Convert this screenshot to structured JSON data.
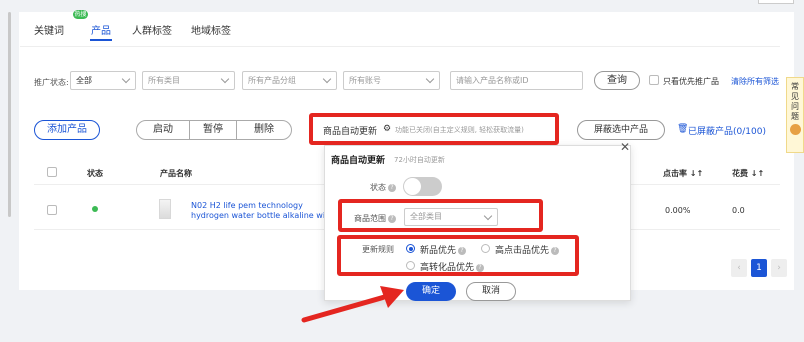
{
  "tabs": [
    {
      "label": "关键词",
      "badge": "热搜"
    },
    {
      "label": "产品"
    },
    {
      "label": "人群标签"
    },
    {
      "label": "地域标签"
    }
  ],
  "filters": {
    "status_label": "推广状态:",
    "status_value": "全部",
    "category_placeholder": "所有类目",
    "group_placeholder": "所有产品分组",
    "account_placeholder": "所有账号",
    "search_placeholder": "请输入产品名称或ID",
    "search_button": "查询",
    "priority_only_label": "只看优先推广品",
    "clear_link": "清除所有筛选"
  },
  "toolbar": {
    "add_product": "添加产品",
    "start": "启动",
    "pause": "暂停",
    "delete": "删除",
    "auto_update_label": "商品自动更新",
    "auto_update_hint": "功能已关闭(自主定义规则, 轻松获取流量)",
    "block_selected": "屏蔽选中产品",
    "blocked_link": "已屏蔽产品(0/100)"
  },
  "table": {
    "headers": [
      "状态",
      "产品名称",
      "点击率 ↓↑",
      "花费 ↓↑"
    ],
    "rows": [
      {
        "title_line1": "N02 H2 life pem technology",
        "title_line2": "hydrogen water bottle alkaline wit...",
        "ctr": "0.00%",
        "cost": "0.0"
      }
    ]
  },
  "pager": {
    "current": "1"
  },
  "help_widget": [
    "常",
    "见",
    "问",
    "题"
  ],
  "popup": {
    "title": "商品自动更新",
    "subtitle": "72小时自动更新",
    "status_label": "状态",
    "scope_label": "商品范围",
    "scope_placeholder": "全部类目",
    "rule_label": "更新规则",
    "rule_options": [
      "新品优先",
      "高点击品优先",
      "高转化品优先"
    ],
    "confirm": "确定",
    "cancel": "取消",
    "close_glyph": "✕"
  },
  "colors": {
    "accent": "#1b55d6",
    "annotation_red": "#e42620",
    "status_green": "#3cba54"
  }
}
